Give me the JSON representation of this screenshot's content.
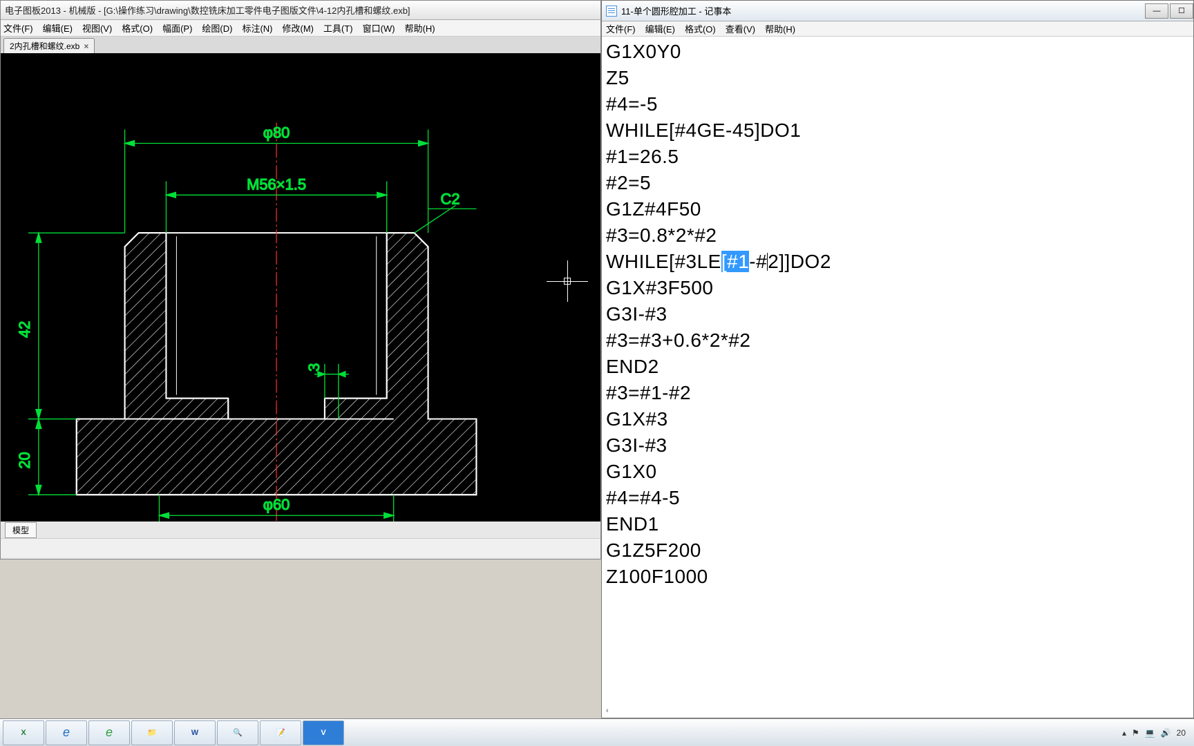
{
  "cad": {
    "title": "电子图板2013 - 机械版 - [G:\\操作练习\\drawing\\数控铣床加工零件电子图版文件\\4-12内孔槽和螺纹.exb]",
    "menu": [
      "文件(F)",
      "编辑(E)",
      "视图(V)",
      "格式(O)",
      "幅面(P)",
      "绘图(D)",
      "标注(N)",
      "修改(M)",
      "工具(T)",
      "窗口(W)",
      "帮助(H)"
    ],
    "doc_tab": "2内孔槽和螺纹.exb",
    "bottom_tab": "模型",
    "dims": {
      "d80": "φ80",
      "m56": "M56×1.5",
      "c2": "C2",
      "h42": "42",
      "h20": "20",
      "d60": "φ60",
      "r3": "3"
    }
  },
  "notepad": {
    "title": "11-单个圆形腔加工 - 记事本",
    "menu": [
      "文件(F)",
      "编辑(E)",
      "格式(O)",
      "查看(V)",
      "帮助(H)"
    ],
    "lines_before_sel": "G1X0Y0\nZ5\n#4=-5\nWHILE[#4GE-45]DO1\n#1=26.5\n#2=5\nG1Z#4F50\n#3=0.8*2*#2\nWHILE[#3LE",
    "sel_text": "[#1",
    "after_sel_before_caret": "-#",
    "caret_then_rest_line": "2]]DO2",
    "lines_after": "G1X#3F500\nG3I-#3\n#3=#3+0.6*2*#2\nEND2\n#3=#1-#2\nG1X#3\nG3I-#3\nG1X0\n#4=#4-5\nEND1\nG1Z5F200\nZ100F1000"
  },
  "taskbar": {
    "apps": [
      "X",
      "e",
      "e",
      "📁",
      "W",
      "🔍",
      "📝",
      "V"
    ],
    "clock": "20"
  }
}
